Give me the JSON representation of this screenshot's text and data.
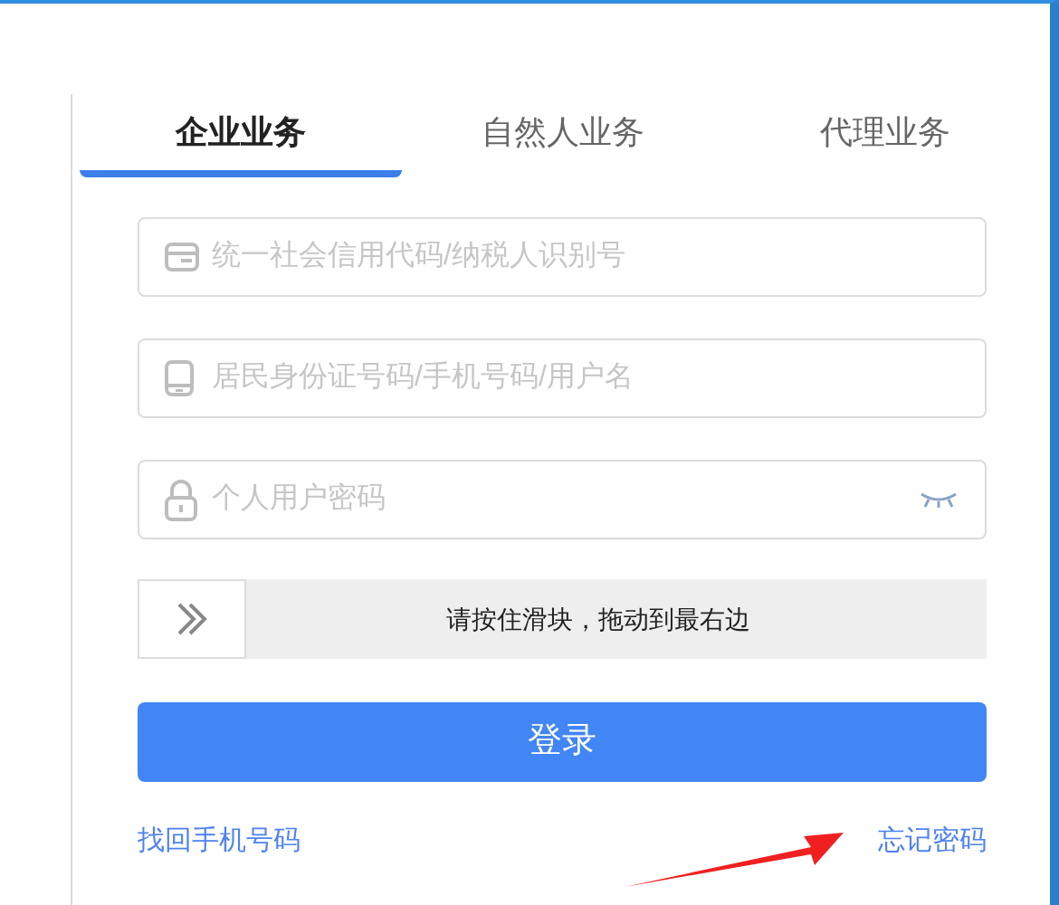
{
  "tabs": [
    {
      "label": "企业业务",
      "selected": true
    },
    {
      "label": "自然人业务",
      "selected": false
    },
    {
      "label": "代理业务",
      "selected": false
    }
  ],
  "fields": [
    {
      "kind": "card",
      "placeholder": "统一社会信用代码/纳税人识别号"
    },
    {
      "kind": "phone",
      "placeholder": "居民身份证号码/手机号码/用户名"
    },
    {
      "kind": "password",
      "placeholder": "个人用户密码"
    }
  ],
  "slider": {
    "text": "请按住滑块，拖动到最右边",
    "level": 0
  },
  "login_button": "登录",
  "links": [
    "找回手机号码",
    "忘记密码"
  ]
}
